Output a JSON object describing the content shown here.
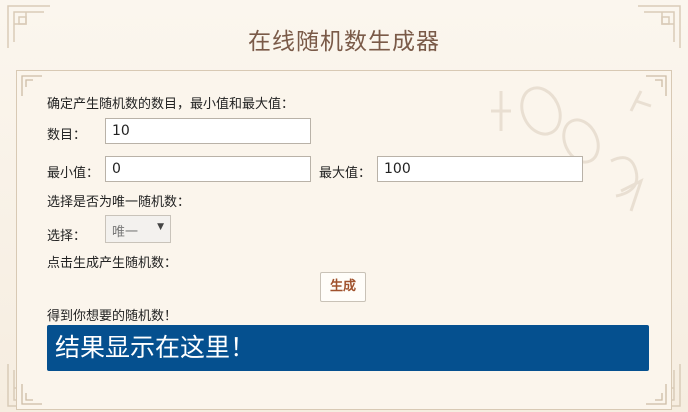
{
  "title": "在线随机数生成器",
  "instruction": "确定产生随机数的数目，最小值和最大值：",
  "count": {
    "label": "数目：",
    "value": "10"
  },
  "min": {
    "label": "最小值：",
    "value": "0"
  },
  "max": {
    "label": "最大值：",
    "value": "100"
  },
  "unique_prompt": "选择是否为唯一随机数：",
  "unique_select": {
    "label": "选择：",
    "selected": "唯一"
  },
  "generate_prompt": "点击生成产生随机数：",
  "generate_button": "生成",
  "result_prompt": "得到你想要的随机数！",
  "result_text": "结果显示在这里！",
  "colors": {
    "title": "#7a5a48",
    "result_bg": "#05508f",
    "button_text": "#a0522d",
    "page_bg": "#f7efe2"
  }
}
